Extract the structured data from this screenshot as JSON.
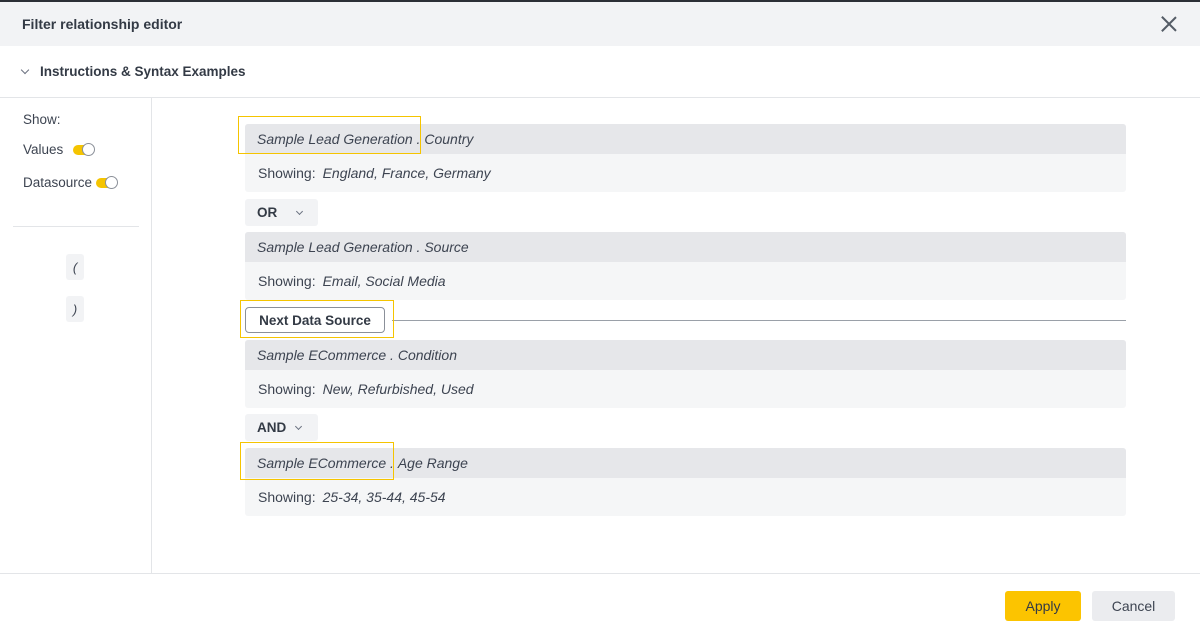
{
  "dialog": {
    "title": "Filter relationship editor"
  },
  "instructions": {
    "label": "Instructions & Syntax Examples"
  },
  "sidebar": {
    "show_label": "Show:",
    "toggles": [
      {
        "label": "Values",
        "on": true
      },
      {
        "label": "Datasource",
        "on": true
      }
    ],
    "parens": {
      "open": "(",
      "close": ")"
    }
  },
  "filters": [
    {
      "datasource": "Sample Lead Generation",
      "field": "Country",
      "showing_label": "Showing:",
      "values": "England, France, Germany"
    },
    {
      "datasource": "Sample Lead Generation",
      "field": "Source",
      "showing_label": "Showing:",
      "values": "Email, Social Media"
    },
    {
      "datasource": "Sample ECommerce",
      "field": "Condition",
      "showing_label": "Showing:",
      "values": "New, Refurbished, Used"
    },
    {
      "datasource": "Sample ECommerce",
      "field": "Age Range",
      "showing_label": "Showing:",
      "values": "25-34, 35-44, 45-54"
    }
  ],
  "operators": [
    "OR",
    "AND"
  ],
  "next_data_source": {
    "label": "Next Data Source"
  },
  "footer": {
    "apply_label": "Apply",
    "cancel_label": "Cancel"
  },
  "colors": {
    "accent": "#fcc400",
    "highlight": "#f5c400",
    "header_bg": "#f2f3f5"
  }
}
